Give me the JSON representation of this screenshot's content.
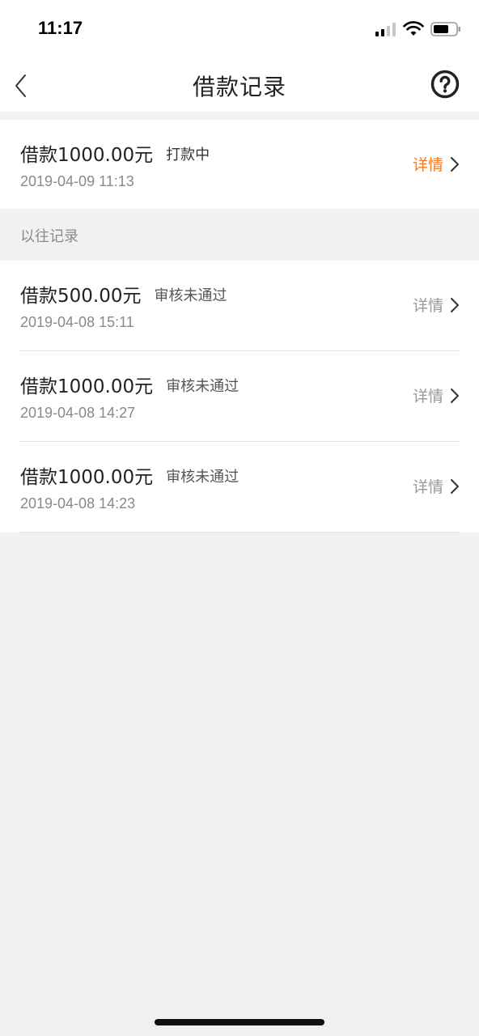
{
  "status_bar": {
    "time": "11:17"
  },
  "nav": {
    "title": "借款记录"
  },
  "current_record": {
    "amount": "借款1000.00元",
    "status": "打款中",
    "time": "2019-04-09 11:13",
    "detail_label": "详情"
  },
  "history": {
    "section_label": "以往记录",
    "records": [
      {
        "amount": "借款500.00元",
        "status": "审核未通过",
        "time": "2019-04-08 15:11",
        "detail_label": "详情"
      },
      {
        "amount": "借款1000.00元",
        "status": "审核未通过",
        "time": "2019-04-08 14:27",
        "detail_label": "详情"
      },
      {
        "amount": "借款1000.00元",
        "status": "审核未通过",
        "time": "2019-04-08 14:23",
        "detail_label": "详情"
      }
    ]
  },
  "colors": {
    "accent": "#f07a28",
    "background": "#f1f1f1"
  }
}
